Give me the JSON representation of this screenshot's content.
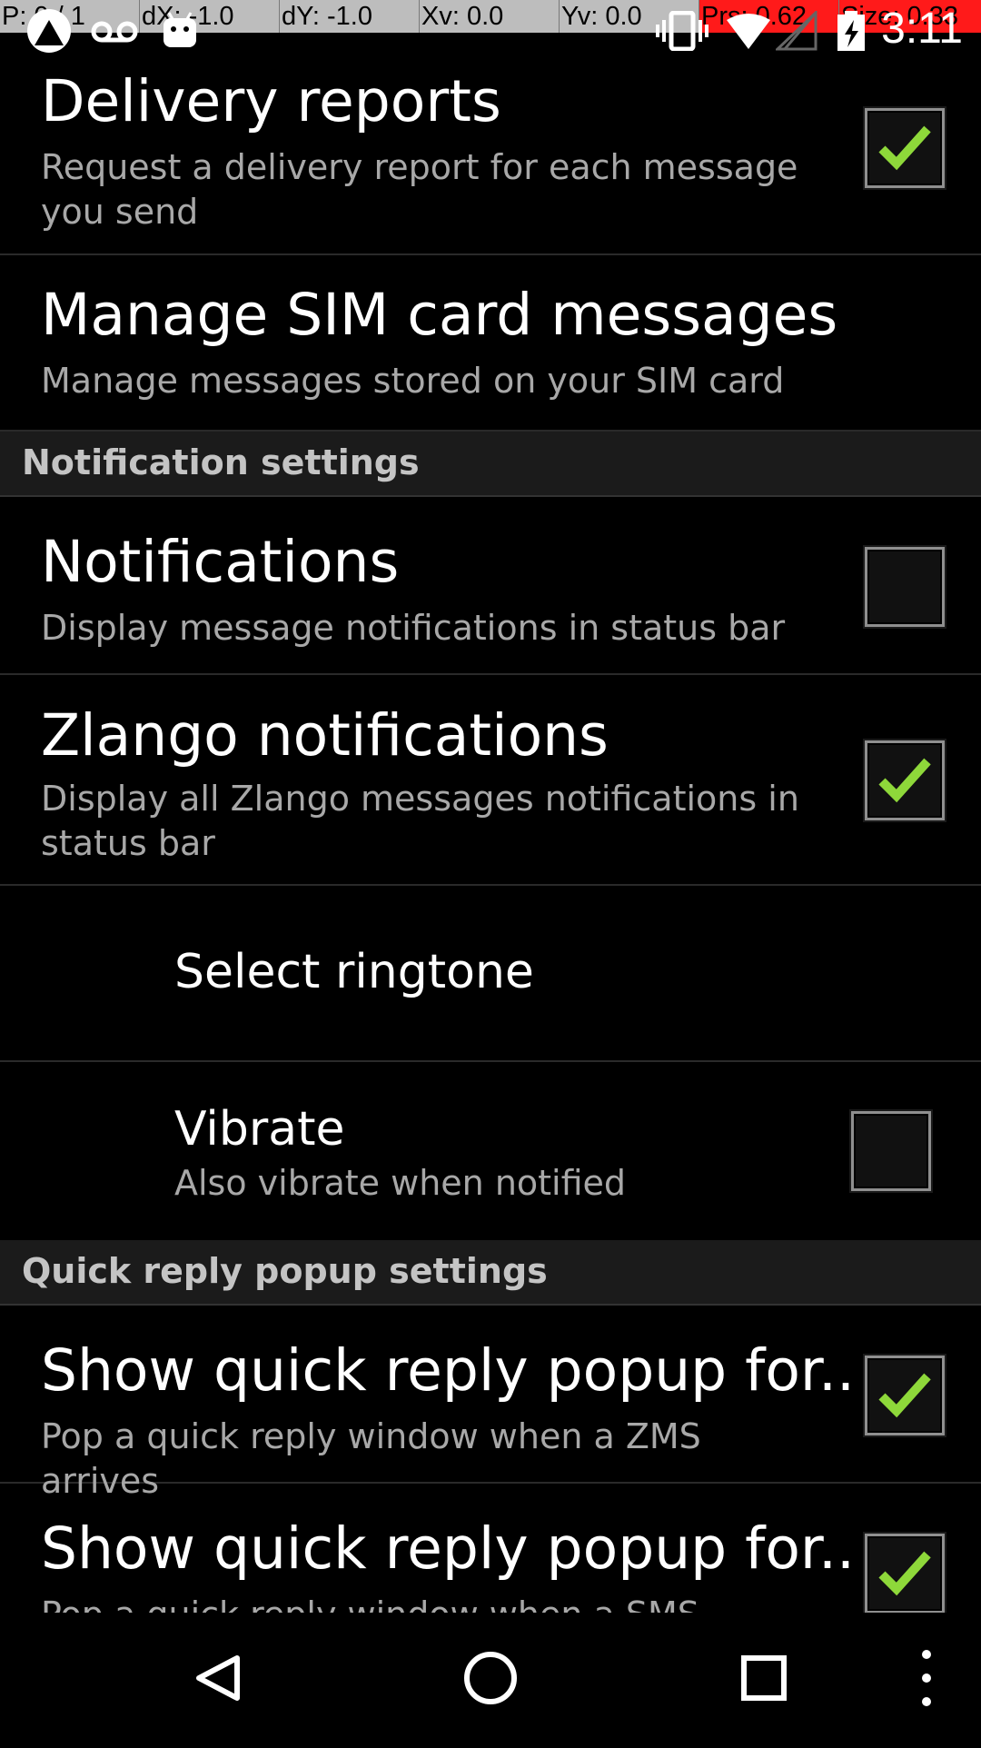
{
  "pointer_overlay": {
    "p": "P: 0 / 1",
    "dx": "dX: -1.0",
    "dy": "dY: -1.0",
    "xv": "Xv: 0.0",
    "yv": "Yv: 0.0",
    "prs": "Prs: 0.62",
    "size": "Size: 0.33"
  },
  "status_bar": {
    "clock": "3:11",
    "icons": [
      "app-icon",
      "voicemail-icon",
      "android-icon",
      "vibrate-icon",
      "wifi-icon",
      "no-signal-icon",
      "battery-charging-icon"
    ]
  },
  "settings": {
    "delivery_reports": {
      "title": "Delivery reports",
      "summary": "Request a delivery report for each message you send",
      "checked": true
    },
    "manage_sim": {
      "title": "Manage SIM card messages",
      "summary": "Manage messages stored on your SIM card"
    },
    "notification_header": "Notification settings",
    "notifications": {
      "title": "Notifications",
      "summary": "Display message notifications in status bar",
      "checked": false
    },
    "zlango_notifications": {
      "title": "Zlango notifications",
      "summary": "Display all Zlango messages notifications in status bar",
      "checked": true
    },
    "select_ringtone": {
      "title": "Select ringtone"
    },
    "vibrate": {
      "title": "Vibrate",
      "summary": "Also vibrate when notified",
      "checked": false
    },
    "quick_reply_header": "Quick reply popup settings",
    "quick_reply_zms": {
      "title": "Show quick reply popup for..",
      "summary": "Pop a quick reply window when a ZMS arrives",
      "checked": true
    },
    "quick_reply_sms": {
      "title": "Show quick reply popup for..",
      "summary": "Pop a quick reply window when a SMS arrives",
      "checked": true
    }
  },
  "nav_bar": {
    "buttons": [
      "back-icon",
      "home-icon",
      "recents-icon",
      "menu-icon"
    ]
  },
  "colors": {
    "check_green": "#8ed83a",
    "header_bg": "#1b1b1b",
    "summary_text": "#a8a8a8"
  }
}
